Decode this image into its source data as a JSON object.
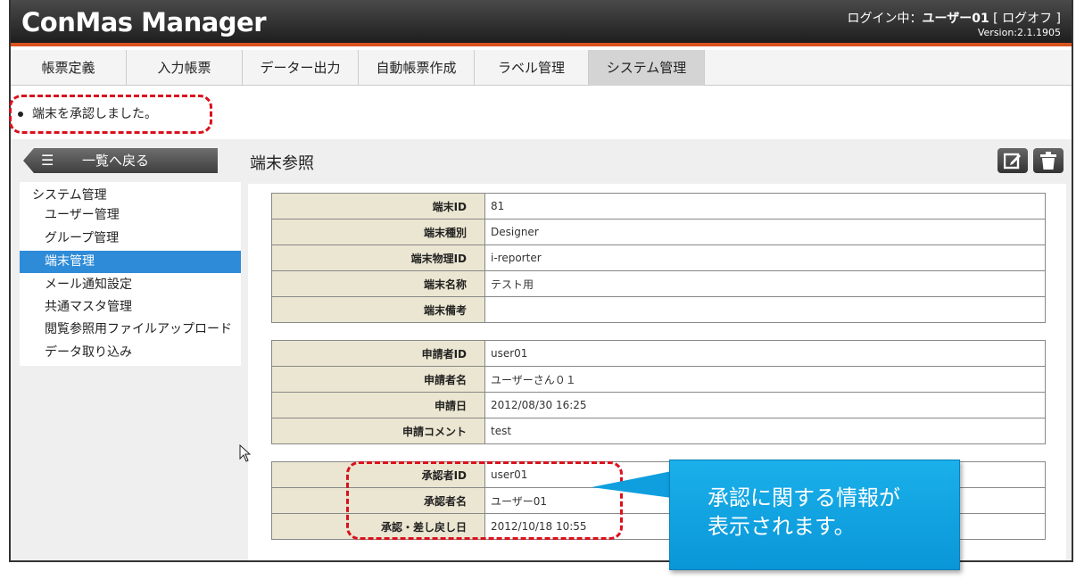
{
  "header": {
    "app_title": "ConMas Manager",
    "login_label": "ログイン中：",
    "user": "ユーザー01",
    "logoff": "[ ログオフ ]",
    "version": "Version:2.1.1905"
  },
  "menu": [
    "帳票定義",
    "入力帳票",
    "データー出力",
    "自動帳票作成",
    "ラベル管理",
    "システム管理"
  ],
  "message": "端末を承認しました。",
  "back_button": "一覧へ戻る",
  "sidebar": {
    "title": "システム管理",
    "items": [
      "ユーザー管理",
      "グループ管理",
      "端末管理",
      "メール通知設定",
      "共通マスタ管理",
      "閲覧参照用ファイルアップロード",
      "データ取り込み"
    ]
  },
  "page_title": "端末参照",
  "icons": {
    "edit": "edit-icon",
    "delete": "trash-icon"
  },
  "terminal": [
    {
      "key": "端末ID",
      "value": "81"
    },
    {
      "key": "端末種別",
      "value": "Designer"
    },
    {
      "key": "端末物理ID",
      "value": "i-reporter"
    },
    {
      "key": "端末名称",
      "value": "テスト用"
    },
    {
      "key": "端末備考",
      "value": ""
    }
  ],
  "request": [
    {
      "key": "申請者ID",
      "value": "user01"
    },
    {
      "key": "申請者名",
      "value": "ユーザーさん０１"
    },
    {
      "key": "申請日",
      "value": "2012/08/30 16:25"
    },
    {
      "key": "申請コメント",
      "value": "test"
    }
  ],
  "approval": [
    {
      "key": "承認者ID",
      "value": "user01"
    },
    {
      "key": "承認者名",
      "value": "ユーザー01"
    },
    {
      "key": "承認・差し戻し日",
      "value": "2012/10/18 10:55"
    }
  ],
  "callout": {
    "line1": "承認に関する情報が",
    "line2": "表示されます。"
  },
  "colors": {
    "accent_orange": "#d9531e",
    "sidebar_active": "#2e8bd8",
    "key_cell": "#ebe6d1",
    "highlight_red": "#d9111c",
    "callout_blue": "#0a96d8"
  }
}
